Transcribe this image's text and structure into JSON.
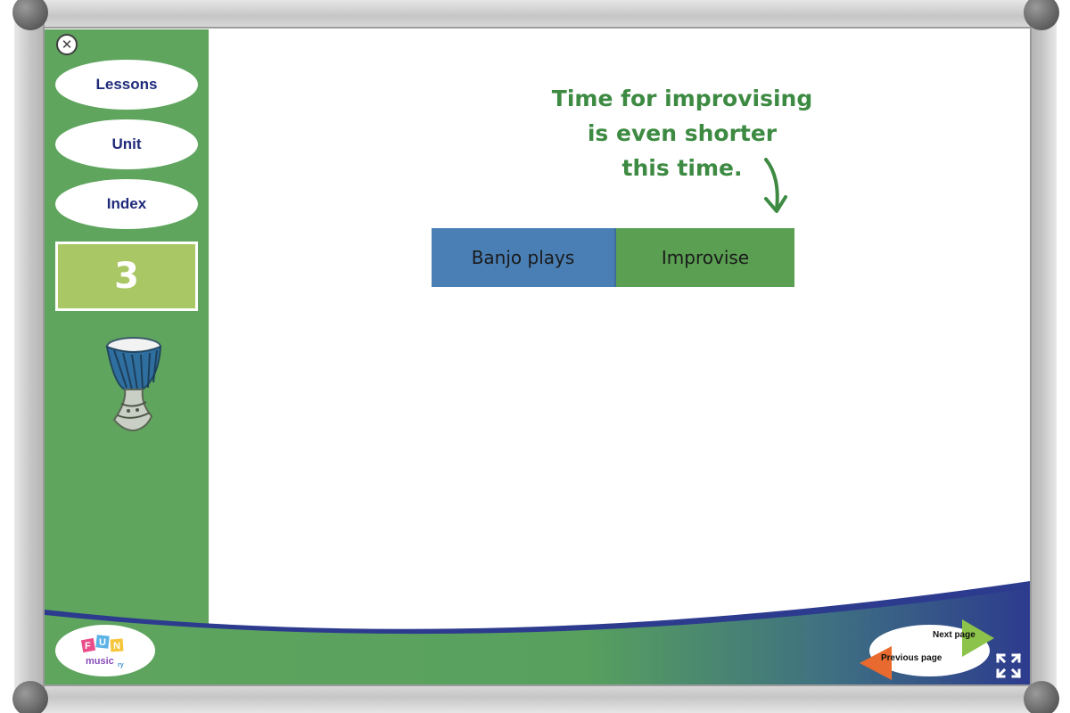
{
  "sidebar": {
    "close_icon": "close-icon",
    "buttons": [
      {
        "label": "Lessons"
      },
      {
        "label": "Unit"
      },
      {
        "label": "Index"
      }
    ],
    "page_number": "3",
    "instrument_icon": "djembe-drum-icon"
  },
  "main": {
    "callout": {
      "lines": [
        "Time for improvising",
        "is even shorter",
        "this time."
      ]
    },
    "sequence": [
      {
        "label": "Banjo plays",
        "color": "#4a7fb5"
      },
      {
        "label": "Improvise",
        "color": "#5a9f52"
      }
    ]
  },
  "footer": {
    "logo": {
      "letters": [
        "F",
        "U",
        "N"
      ],
      "word": "music",
      "suffix": "ry"
    },
    "nav": {
      "next_label": "Next page",
      "prev_label": "Previous page"
    },
    "fullscreen_icon": "fullscreen-icon"
  },
  "colors": {
    "sidebar_green": "#5fa55e",
    "footer_navy": "#2d3b8e",
    "text_navy": "#1f2b7a",
    "callout_green": "#3d8a42",
    "page_box_green": "#a9c764",
    "next_arrow": "#8cc34b",
    "prev_arrow": "#e86a2e"
  }
}
